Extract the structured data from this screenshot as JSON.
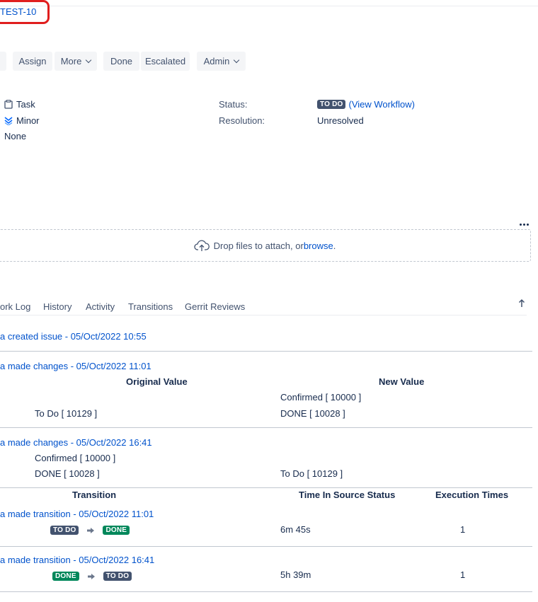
{
  "issue": {
    "key": "TEST-10"
  },
  "toolbar": {
    "assign": "Assign",
    "more": "More",
    "done": "Done",
    "escalated": "Escalated",
    "admin": "Admin"
  },
  "details": {
    "type": "Task",
    "priority": "Minor",
    "affects": "None",
    "status_label": "Status:",
    "status_value": "TO DO",
    "view_workflow_open": "(",
    "view_workflow": "View Workflow",
    "view_workflow_close": ")",
    "resolution_label": "Resolution:",
    "resolution_value": "Unresolved"
  },
  "attachments": {
    "drop_text": "Drop files to attach, or ",
    "browse": "browse",
    "period": "."
  },
  "tabs": [
    "ork Log",
    "History",
    "Activity",
    "Transitions",
    "Gerrit Reviews"
  ],
  "history": {
    "created": "a created issue - 05/Oct/2022 10:55",
    "change1": {
      "header": "a made changes - 05/Oct/2022 11:01",
      "original_header": "Original Value",
      "new_header": "New Value",
      "row1_new": "Confirmed [ 10000 ]",
      "row2_orig": "To Do [ 10129 ]",
      "row2_new": "DONE [ 10028 ]"
    },
    "change2": {
      "header": "a made changes - 05/Oct/2022 16:41",
      "row1_orig": "Confirmed [ 10000 ]",
      "row2_orig": "DONE [ 10028 ]",
      "row2_new": "To Do [ 10129 ]"
    }
  },
  "transitions": {
    "col_transition": "Transition",
    "col_time": "Time In Source Status",
    "col_exec": "Execution Times",
    "rows": [
      {
        "header": "a made transition - 05/Oct/2022 11:01",
        "from": "TO DO",
        "to": "DONE",
        "time": "6m 45s",
        "count": "1"
      },
      {
        "header": "a made transition - 05/Oct/2022 16:41",
        "from": "DONE",
        "to": "TO DO",
        "time": "5h 39m",
        "count": "1"
      }
    ]
  },
  "colors": {
    "link": "#0052cc",
    "todo": "#42526e",
    "done": "#00875a",
    "highlight": "#e01e1e"
  }
}
